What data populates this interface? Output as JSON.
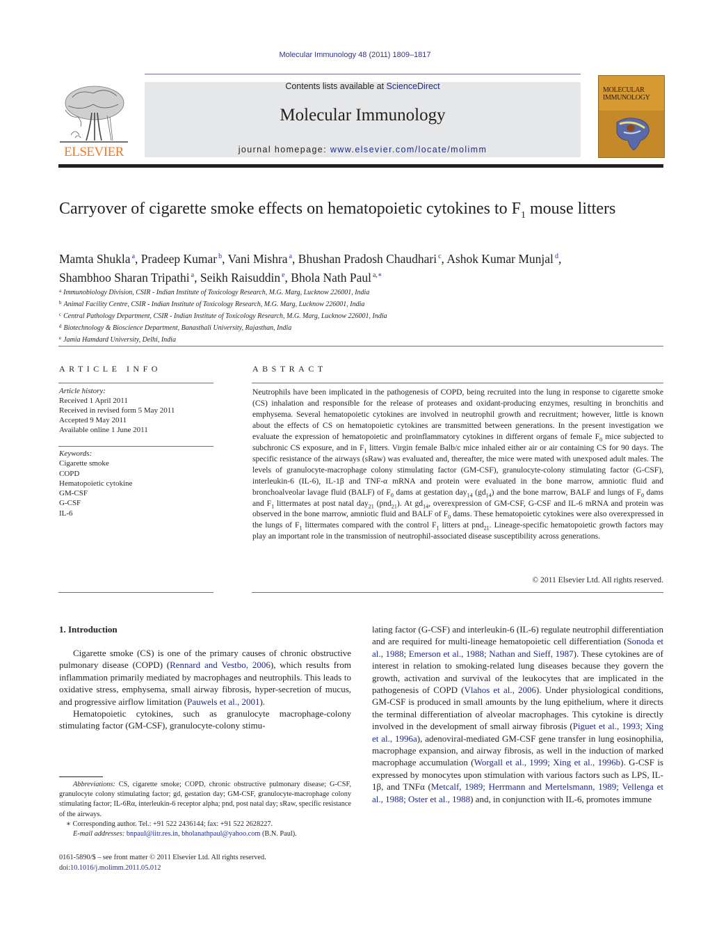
{
  "header": {
    "journal_ref": "Molecular Immunology 48 (2011) 1809–1817",
    "contents_prefix": "Contents lists available at ",
    "contents_link": "ScienceDirect",
    "journal_title": "Molecular Immunology",
    "homepage_prefix": "journal homepage: ",
    "homepage_link": "www.elsevier.com/locate/molimm",
    "publisher_logo_text": "ELSEVIER",
    "cover_title_line1": "MOLECULAR",
    "cover_title_line2": "IMMUNOLOGY",
    "colors": {
      "link": "#2e3192",
      "elsevier_orange": "#f47a20",
      "banner_gray": "#e6e7e8",
      "cover_gold": "#d79a33"
    }
  },
  "article": {
    "title_part1": "Carryover of cigarette smoke effects on hematopoietic cytokines to F",
    "title_sub": "1",
    "title_part2": " mouse litters",
    "authors": [
      {
        "name": "Mamta Shukla",
        "aff": "a"
      },
      {
        "name": "Pradeep Kumar",
        "aff": "b"
      },
      {
        "name": "Vani Mishra",
        "aff": "a"
      },
      {
        "name": "Bhushan Pradosh Chaudhari",
        "aff": "c"
      },
      {
        "name": "Ashok Kumar Munjal",
        "aff": "d"
      },
      {
        "name": "Shambhoo Sharan Tripathi",
        "aff": "a"
      },
      {
        "name": "Seikh Raisuddin",
        "aff": "e"
      },
      {
        "name": "Bhola Nath Paul",
        "aff": "a,∗"
      }
    ],
    "affiliations": [
      {
        "key": "a",
        "text": "Immunobiology Division, CSIR - Indian Institute of Toxicology Research, M.G. Marg, Lucknow 226001, India"
      },
      {
        "key": "b",
        "text": "Animal Facility Centre, CSIR - Indian Institute of Toxicology Research, M.G. Marg, Lucknow 226001, India"
      },
      {
        "key": "c",
        "text": "Central Pathology Department, CSIR - Indian Institute of Toxicology Research, M.G. Marg, Lucknow 226001, India"
      },
      {
        "key": "d",
        "text": "Biotechnology & Bioscience Department, Banasthali University, Rajasthan, India"
      },
      {
        "key": "e",
        "text": "Jamia Hamdard University, Delhi, India"
      }
    ]
  },
  "article_info": {
    "heading": "ARTICLE INFO",
    "history_label": "Article history:",
    "history": [
      "Received 1 April 2011",
      "Received in revised form 5 May 2011",
      "Accepted 9 May 2011",
      "Available online 1 June 2011"
    ],
    "keywords_label": "Keywords:",
    "keywords": [
      "Cigarette smoke",
      "COPD",
      "Hematopoietic cytokine",
      "GM-CSF",
      "G-CSF",
      "IL-6"
    ]
  },
  "abstract": {
    "heading": "ABSTRACT",
    "s1": "Neutrophils have been implicated in the pathogenesis of COPD, being recruited into the lung in response to cigarette smoke (CS) inhalation and responsible for the release of proteases and oxidant-producing enzymes, resulting in bronchitis and emphysema. Several hematopoietic cytokines are involved in neutrophil growth and recruitment; however, little is known about the effects of CS on hematopoietic cytokines are transmitted between generations. In the present investigation we evaluate the expression of hematopoietic and proinflammatory cytokines in different organs of female F",
    "s2": " mice subjected to subchronic CS exposure, and in F",
    "s3": " litters. Virgin female Balb/c mice inhaled either air or air containing CS for 90 days. The specific resistance of the airways (sRaw) was evaluated and, thereafter, the mice were mated with unexposed adult males. The levels of granulocyte-macrophage colony stimulating factor (GM-CSF), granulocyte-colony stimulating factor (G-CSF), interleukin-6 (IL-6), IL-1β and TNF-α mRNA and protein were evaluated in the bone marrow, amniotic fluid and bronchoalveolar lavage fluid (BALF) of F",
    "s4": " dams at gestation day",
    "s5": " (gd",
    "s6": ") and the bone marrow, BALF and lungs of F",
    "s7": " dams and F",
    "s8": " littermates at post natal day",
    "s9": " (pnd",
    "s10": "). At gd",
    "s11": ", overexpression of GM-CSF, G-CSF and IL-6 mRNA and protein was observed in the bone marrow, amniotic fluid and BALF of F",
    "s12": " dams. These hematopoietic cytokines were also overexpressed in the lungs of F",
    "s13": " littermates compared with the control F",
    "s14": " litters at pnd",
    "s15": ". Lineage-specific hematopoietic growth factors may play an important role in the transmission of neutrophil-associated disease susceptibility across generations.",
    "sub0": "0",
    "sub1": "1",
    "sub14": "14",
    "sub21": "21",
    "copyright": "© 2011 Elsevier Ltd. All rights reserved."
  },
  "body": {
    "section_heading": "1.  Introduction",
    "left": {
      "p1a": "Cigarette smoke (CS) is one of the primary causes of chronic obstructive pulmonary disease (COPD) (",
      "p1_ref1": "Rennard and Vestbo, 2006",
      "p1b": "), which results from inflammation primarily mediated by macrophages and neutrophils. This leads to oxidative stress, emphysema, small airway fibrosis, hyper-secretion of mucus, and progressive airflow limitation (",
      "p1_ref2": "Pauwels et al., 2001",
      "p1c": ").",
      "p2": "Hematopoietic cytokines, such as granulocyte macrophage-colony stimulating factor (GM-CSF), granulocyte-colony stimu-"
    },
    "right": {
      "a": "lating factor (G-CSF) and interleukin-6 (IL-6) regulate neutrophil differentiation and are required for multi-lineage hematopoietic cell differentiation (",
      "ref1": "Sonoda et al., 1988; Emerson et al., 1988; Nathan and Sieff, 1987",
      "b": "). These cytokines are of interest in relation to smoking-related lung diseases because they govern the growth, activation and survival of the leukocytes that are implicated in the pathogenesis of COPD (",
      "ref2": "Vlahos et al., 2006",
      "c": "). Under physiological conditions, GM-CSF is produced in small amounts by the lung epithelium, where it directs the terminal differentiation of alveolar macrophages. This cytokine is directly involved in the development of small airway fibrosis (",
      "ref3": "Piguet et al., 1993; Xing et al., 1996a",
      "d": "), adenoviral-mediated GM-CSF gene transfer in lung eosinophilia, macrophage expansion, and airway fibrosis, as well in the induction of marked macrophage accumulation (",
      "ref4": "Worgall et al., 1999; Xing et al., 1996b",
      "e": "). G-CSF is expressed by monocytes upon stimulation with various factors such as LPS, IL-1β, and TNFα (",
      "ref5": "Metcalf, 1989; Herrmann and Mertelsmann, 1989; Vellenga et al., 1988; Oster et al., 1988",
      "f": ") and, in conjunction with IL-6, promotes immune"
    }
  },
  "footnotes": {
    "abbrev_label": "Abbreviations:",
    "abbrev_text": "  CS, cigarette smoke; COPD, chronic obstructive pulmonary disease; G-CSF, granulocyte colony stimulating factor; gd, gestation day; GM-CSF, granulocyte-macrophage colony stimulating factor; IL-6Rα, interleukin-6 receptor alpha; pnd, post natal day; sRaw, specific resistance of the airways.",
    "corresponding": "∗ Corresponding author. Tel.: +91 522 2436144; fax: +91 522 2628227.",
    "email_label": "E-mail addresses:",
    "email1": "bnpaul@iitr.res.in",
    "email_sep": ", ",
    "email2": "bholanathpaul@yahoo.com",
    "email_owner": " (B.N. Paul).",
    "issn": "0161-5890/$ – see front matter © 2011 Elsevier Ltd. All rights reserved.",
    "doi_prefix": "doi:",
    "doi": "10.1016/j.molimm.2011.05.012"
  }
}
